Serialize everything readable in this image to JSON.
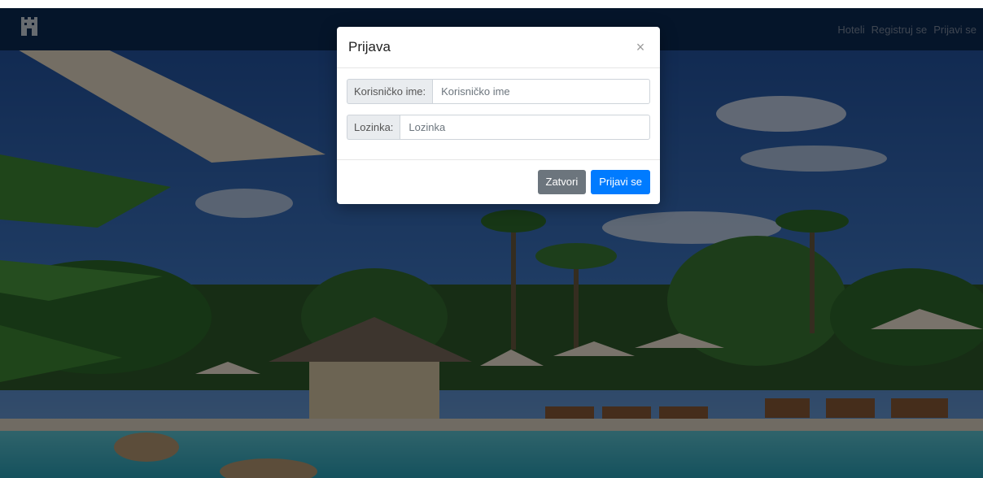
{
  "navbar": {
    "brand_icon": "castle-icon",
    "links": [
      {
        "label": "Hoteli"
      },
      {
        "label": "Registruj se"
      },
      {
        "label": "Prijavi se"
      }
    ]
  },
  "modal": {
    "title": "Prijava",
    "close_glyph": "×",
    "fields": [
      {
        "label": "Korisničko ime:",
        "placeholder": "Korisničko ime",
        "value": ""
      },
      {
        "label": "Lozinka:",
        "placeholder": "Lozinka",
        "value": ""
      }
    ],
    "buttons": {
      "close_label": "Zatvori",
      "submit_label": "Prijavi se"
    }
  },
  "colors": {
    "navbar": "#0a2a55",
    "primary": "#007bff",
    "secondary": "#6c757d"
  }
}
